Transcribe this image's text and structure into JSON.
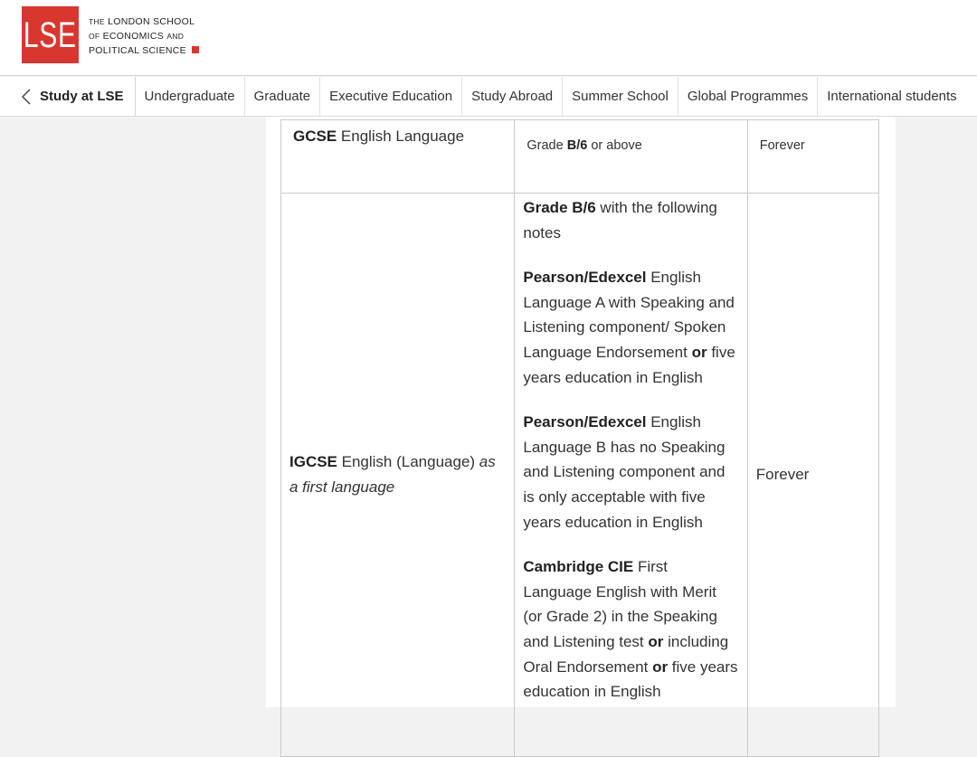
{
  "header": {
    "logo_letters": "LSE",
    "logo_line1_prefix": "THE",
    "logo_line1_main": "LONDON SCHOOL",
    "logo_line2_prefix": "OF",
    "logo_line2_main": "ECONOMICS",
    "logo_line2_suffix": "AND",
    "logo_line3": "POLITICAL SCIENCE",
    "brand_color": "#d7372f"
  },
  "nav": {
    "back_label": "Study at LSE",
    "items": [
      "Undergraduate",
      "Graduate",
      "Executive Education",
      "Study Abroad",
      "Summer School",
      "Global Programmes",
      "International students"
    ]
  },
  "table": {
    "row1": {
      "qual_bold": "GCSE",
      "qual_rest": " English Language",
      "grade_pre": "Grade ",
      "grade_bold": "B/6",
      "grade_post": " or above",
      "validity": "Forever"
    },
    "row2": {
      "qual_bold": "IGCSE",
      "qual_rest": " English (Language) ",
      "qual_italic": "as a first language",
      "validity": "Forever",
      "note0_bold": "Grade B/6",
      "note0_rest": " with the following notes",
      "note1_bold": "Pearson/Edexcel",
      "note1_a": " English Language A with Speaking and Listening component/ Spoken Language Endorsement ",
      "note1_or": "or",
      "note1_b": " five years education in English",
      "note2_bold": "Pearson/Edexcel",
      "note2_rest": " English Language B has no Speaking and Listening component and is only acceptable with five years education in English",
      "note3_bold": "Cambridge CIE",
      "note3_a": " First Language English with Merit (or Grade 2) in the Speaking and Listening test ",
      "note3_or1": "or",
      "note3_b": " including Oral Endorsement ",
      "note3_or2": "or",
      "note3_c": " five years education in English"
    }
  }
}
